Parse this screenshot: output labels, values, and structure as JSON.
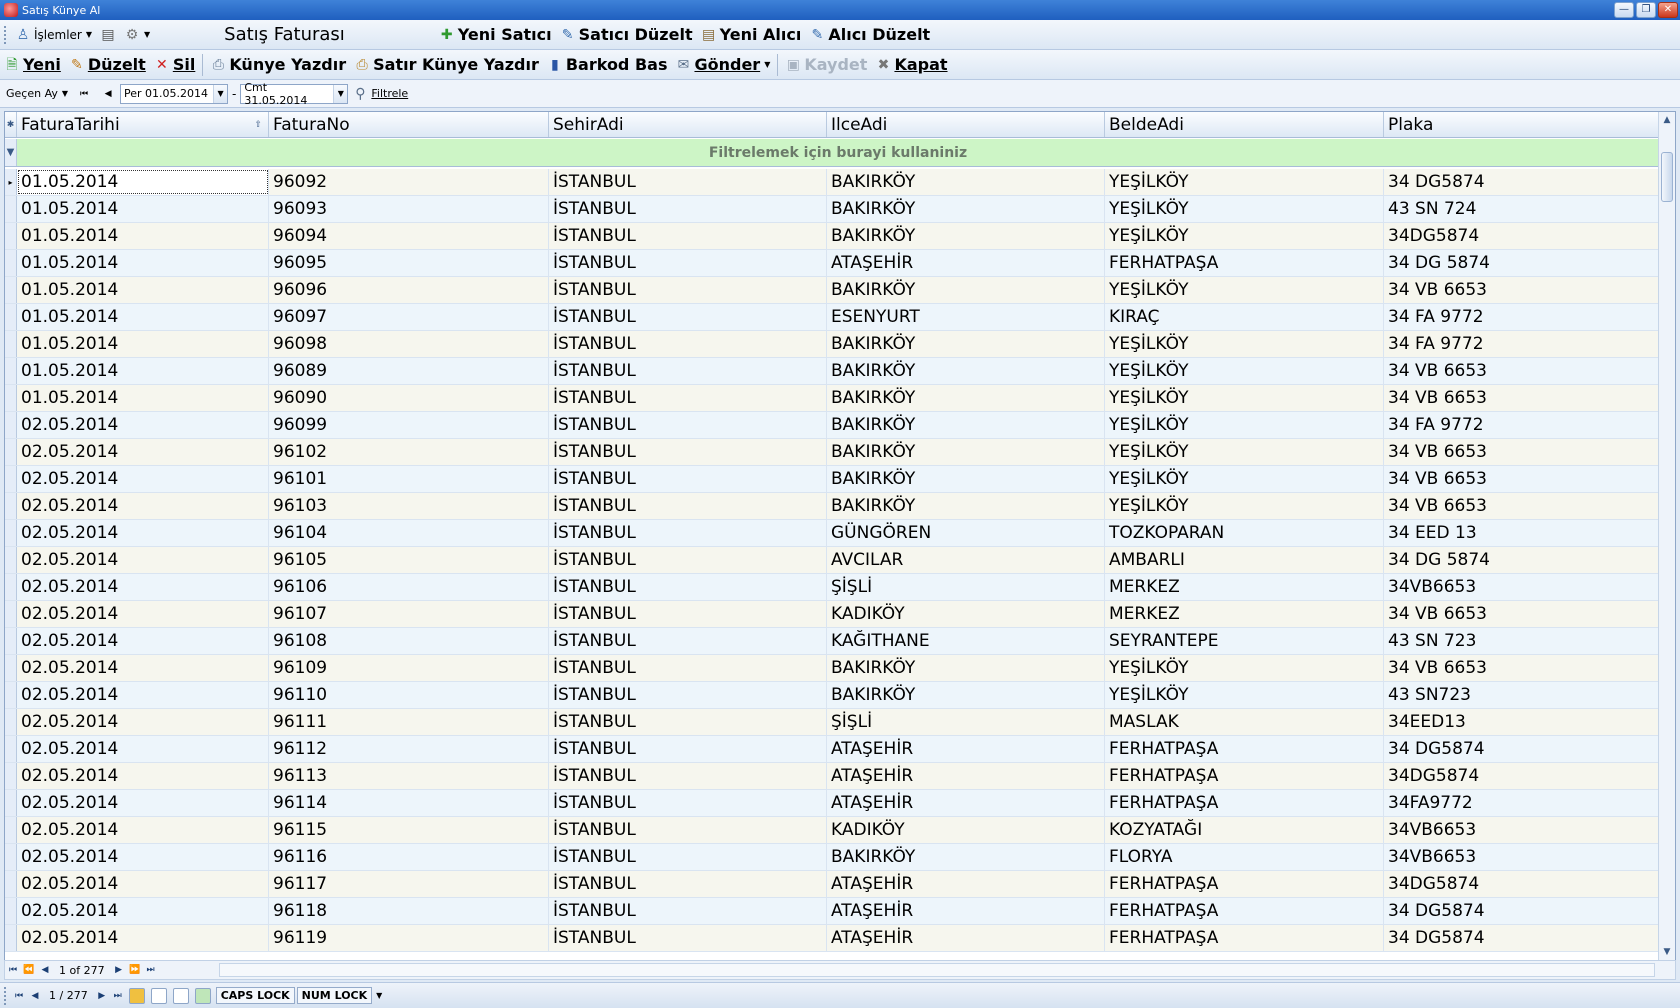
{
  "window": {
    "title": "Satış Künye Al"
  },
  "toolbar1": {
    "menu_label": "İşlemler",
    "form_title": "Satış Faturası",
    "new_seller": "Yeni Satıcı",
    "edit_seller": "Satıcı Düzelt",
    "new_buyer": "Yeni Alıcı",
    "edit_buyer": "Alıcı Düzelt"
  },
  "toolbar2": {
    "new": "Yeni",
    "edit": "Düzelt",
    "delete": "Sil",
    "print_kunye": "Künye Yazdır",
    "print_row_kunye": "Satır Künye Yazdır",
    "print_barcode": "Barkod Bas",
    "send": "Gönder",
    "save": "Kaydet",
    "close": "Kapat"
  },
  "toolbar3": {
    "period": "Geçen Ay",
    "date_from": "Per 01.05.2014",
    "dash": "-",
    "date_to": "Cmt 31.05.2014",
    "filter": "Filtrele"
  },
  "grid": {
    "columns": [
      "FaturaTarihi",
      "FaturaNo",
      "SehirAdi",
      "IlceAdi",
      "BeldeAdi",
      "Plaka"
    ],
    "filter_hint": "Filtrelemek için burayi kullaniniz",
    "rows": [
      [
        "01.05.2014",
        "96092",
        "İSTANBUL",
        "BAKIRKÖY",
        "YEŞİLKÖY",
        "34 DG5874"
      ],
      [
        "01.05.2014",
        "96093",
        "İSTANBUL",
        "BAKIRKÖY",
        "YEŞİLKÖY",
        "43 SN 724"
      ],
      [
        "01.05.2014",
        "96094",
        "İSTANBUL",
        "BAKIRKÖY",
        "YEŞİLKÖY",
        "34DG5874"
      ],
      [
        "01.05.2014",
        "96095",
        "İSTANBUL",
        "ATAŞEHİR",
        "FERHATPAŞA",
        "34 DG 5874"
      ],
      [
        "01.05.2014",
        "96096",
        "İSTANBUL",
        "BAKIRKÖY",
        "YEŞİLKÖY",
        "34 VB 6653"
      ],
      [
        "01.05.2014",
        "96097",
        "İSTANBUL",
        "ESENYURT",
        "KIRAÇ",
        "34 FA 9772"
      ],
      [
        "01.05.2014",
        "96098",
        "İSTANBUL",
        "BAKIRKÖY",
        "YEŞİLKÖY",
        "34 FA 9772"
      ],
      [
        "01.05.2014",
        "96089",
        "İSTANBUL",
        "BAKIRKÖY",
        "YEŞİLKÖY",
        "34 VB 6653"
      ],
      [
        "01.05.2014",
        "96090",
        "İSTANBUL",
        "BAKIRKÖY",
        "YEŞİLKÖY",
        "34 VB 6653"
      ],
      [
        "02.05.2014",
        "96099",
        "İSTANBUL",
        "BAKIRKÖY",
        "YEŞİLKÖY",
        "34 FA 9772"
      ],
      [
        "02.05.2014",
        "96102",
        "İSTANBUL",
        "BAKIRKÖY",
        "YEŞİLKÖY",
        "34 VB 6653"
      ],
      [
        "02.05.2014",
        "96101",
        "İSTANBUL",
        "BAKIRKÖY",
        "YEŞİLKÖY",
        "34 VB 6653"
      ],
      [
        "02.05.2014",
        "96103",
        "İSTANBUL",
        "BAKIRKÖY",
        "YEŞİLKÖY",
        "34 VB 6653"
      ],
      [
        "02.05.2014",
        "96104",
        "İSTANBUL",
        "GÜNGÖREN",
        "TOZKOPARAN",
        "34 EED 13"
      ],
      [
        "02.05.2014",
        "96105",
        "İSTANBUL",
        "AVCILAR",
        "AMBARLI",
        "34 DG 5874"
      ],
      [
        "02.05.2014",
        "96106",
        "İSTANBUL",
        "ŞİŞLİ",
        "MERKEZ",
        "34VB6653"
      ],
      [
        "02.05.2014",
        "96107",
        "İSTANBUL",
        "KADIKÖY",
        "MERKEZ",
        "34 VB 6653"
      ],
      [
        "02.05.2014",
        "96108",
        "İSTANBUL",
        "KAĞITHANE",
        "SEYRANTEPE",
        "43 SN 723"
      ],
      [
        "02.05.2014",
        "96109",
        "İSTANBUL",
        "BAKIRKÖY",
        "YEŞİLKÖY",
        "34 VB 6653"
      ],
      [
        "02.05.2014",
        "96110",
        "İSTANBUL",
        "BAKIRKÖY",
        "YEŞİLKÖY",
        "43 SN723"
      ],
      [
        "02.05.2014",
        "96111",
        "İSTANBUL",
        "ŞİŞLİ",
        "MASLAK",
        "34EED13"
      ],
      [
        "02.05.2014",
        "96112",
        "İSTANBUL",
        "ATAŞEHİR",
        "FERHATPAŞA",
        "34 DG5874"
      ],
      [
        "02.05.2014",
        "96113",
        "İSTANBUL",
        "ATAŞEHİR",
        "FERHATPAŞA",
        "34DG5874"
      ],
      [
        "02.05.2014",
        "96114",
        "İSTANBUL",
        "ATAŞEHİR",
        "FERHATPAŞA",
        "34FA9772"
      ],
      [
        "02.05.2014",
        "96115",
        "İSTANBUL",
        "KADIKÖY",
        "KOZYATAĞI",
        "34VB6653"
      ],
      [
        "02.05.2014",
        "96116",
        "İSTANBUL",
        "BAKIRKÖY",
        "FLORYA",
        "34VB6653"
      ],
      [
        "02.05.2014",
        "96117",
        "İSTANBUL",
        "ATAŞEHİR",
        "FERHATPAŞA",
        "34DG5874"
      ],
      [
        "02.05.2014",
        "96118",
        "İSTANBUL",
        "ATAŞEHİR",
        "FERHATPAŞA",
        "34 DG5874"
      ],
      [
        "02.05.2014",
        "96119",
        "İSTANBUL",
        "ATAŞEHİR",
        "FERHATPAŞA",
        "34 DG5874"
      ]
    ]
  },
  "grid_nav": {
    "page_text": "1 of 277"
  },
  "statusbar": {
    "page_text": "1 / 277",
    "caps": "CAPS LOCK",
    "num": "NUM LOCK"
  }
}
